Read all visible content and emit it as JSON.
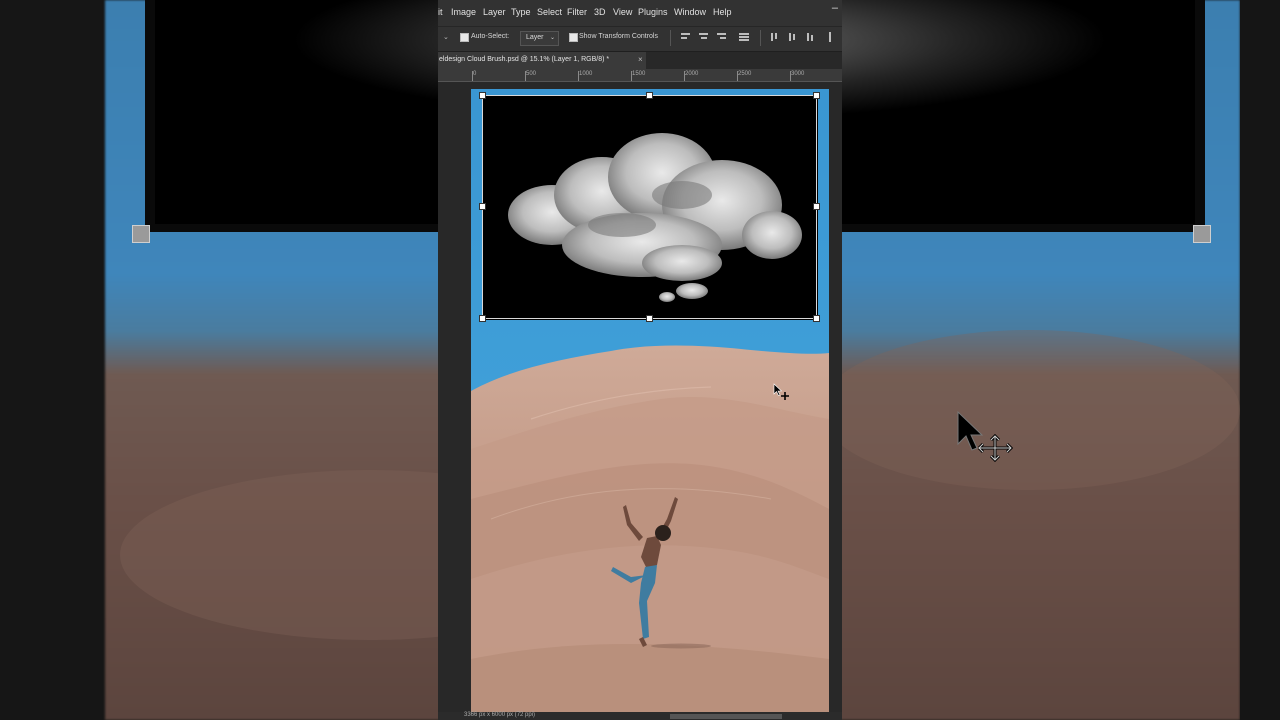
{
  "app": {
    "menu": [
      "it",
      "Image",
      "Layer",
      "Type",
      "Select",
      "Filter",
      "3D",
      "View",
      "Plugins",
      "Window",
      "Help"
    ],
    "minimize": "–"
  },
  "options": {
    "auto_select_label": "Auto-Select:",
    "auto_select_target": "Layer",
    "show_transform_label": "Show Transform Controls"
  },
  "document": {
    "tab_title": "eldesign Cloud Brush.psd @ 15.1% (Layer 1, RGB/8) *",
    "tab_close": "×",
    "ruler_ticks": [
      "0",
      "500",
      "1000",
      "1500",
      "2000",
      "2500",
      "3000"
    ],
    "status": "3366 px x 6000 px (72 ppi)"
  },
  "colors": {
    "sky": "#3e9fd9",
    "sand": "#c29a89",
    "ui_panel": "#323232"
  },
  "icons": [
    "move-cursor-icon",
    "align-left-icon",
    "align-center-icon",
    "align-right-icon",
    "distribute-icon"
  ]
}
